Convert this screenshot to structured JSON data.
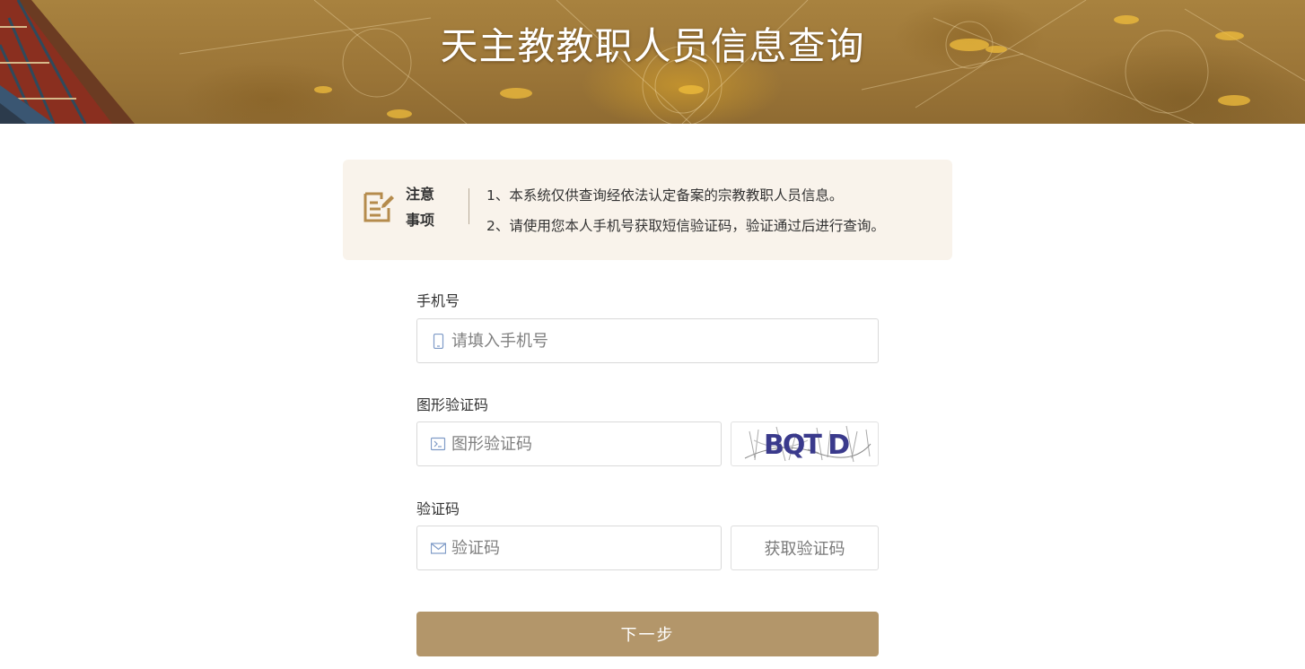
{
  "header": {
    "title": "天主教教职人员信息查询"
  },
  "notice": {
    "icon": "edit-document-icon",
    "title": "注意事项",
    "lines": [
      "1、本系统仅供查询经依法认定备案的宗教教职人员信息。",
      "2、请使用您本人手机号获取短信验证码，验证通过后进行查询。"
    ]
  },
  "form": {
    "phone": {
      "label": "手机号",
      "placeholder": "请填入手机号",
      "value": "",
      "icon": "mobile-phone-icon"
    },
    "captcha": {
      "label": "图形验证码",
      "placeholder": "图形验证码",
      "value": "",
      "icon": "terminal-icon",
      "image_text": "BQT D"
    },
    "sms_code": {
      "label": "验证码",
      "placeholder": "验证码",
      "value": "",
      "icon": "mail-icon",
      "button_label": "获取验证码"
    },
    "submit_label": "下一步"
  },
  "colors": {
    "banner": "#9c7638",
    "notice_bg": "#f9f3eb",
    "accent": "#b3966a",
    "icon_gold": "#b58b4c",
    "input_icon": "#7f9bc7"
  }
}
